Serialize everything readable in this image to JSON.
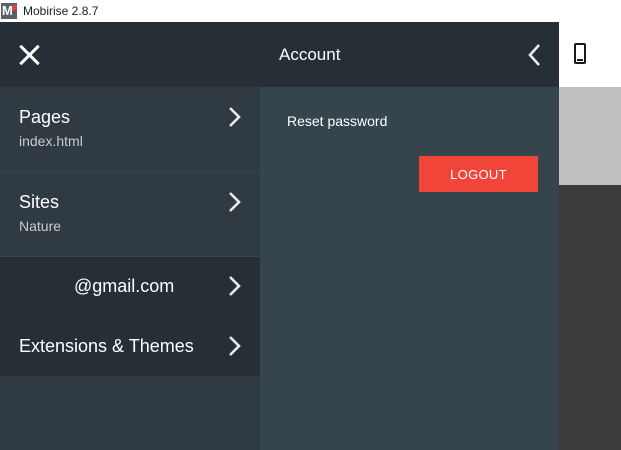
{
  "window": {
    "title": "Mobirise 2.8.7"
  },
  "sidebar": {
    "close_icon": "close-icon",
    "items": [
      {
        "id": "pages",
        "label": "Pages",
        "sub": "index.html",
        "icon": "chevron-right-icon"
      },
      {
        "id": "sites",
        "label": "Sites",
        "sub": "Nature",
        "icon": "chevron-right-icon"
      },
      {
        "id": "account",
        "label": "@gmail.com",
        "icon": "chevron-right-icon"
      },
      {
        "id": "extensions",
        "label": "Extensions & Themes",
        "icon": "chevron-right-icon"
      }
    ]
  },
  "account_panel": {
    "title": "Account",
    "back_icon": "chevron-left-icon",
    "reset_password": "Reset password",
    "logout_label": "LOGOUT"
  },
  "preview": {
    "device_icon": "phone-icon"
  },
  "colors": {
    "sidebar_bg": "#2f3a42",
    "header_bg": "#262f36",
    "panel_bg": "#36444d",
    "logout_red": "#f2453a"
  }
}
